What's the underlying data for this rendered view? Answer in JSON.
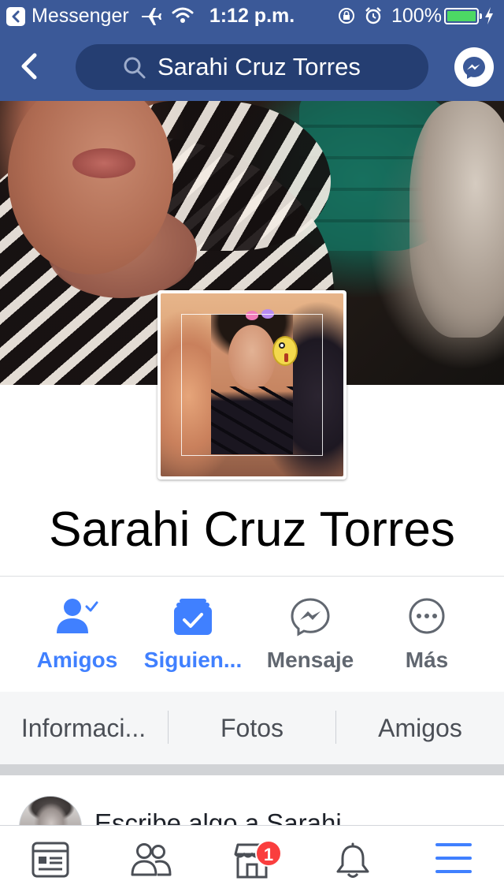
{
  "status_bar": {
    "back_app": "Messenger",
    "time": "1:12 p.m.",
    "battery_percent": "100%",
    "battery_level": 1.0
  },
  "nav": {
    "search_query": "Sarahi Cruz Torres"
  },
  "profile": {
    "name": "Sarahi Cruz Torres"
  },
  "actions": [
    {
      "label": "Amigos",
      "icon": "friends-check-icon",
      "active": true
    },
    {
      "label": "Siguien...",
      "icon": "following-icon",
      "active": true
    },
    {
      "label": "Mensaje",
      "icon": "messenger-icon",
      "active": false
    },
    {
      "label": "Más",
      "icon": "more-icon",
      "active": false
    }
  ],
  "tabs": [
    {
      "label": "Informaci..."
    },
    {
      "label": "Fotos"
    },
    {
      "label": "Amigos"
    }
  ],
  "composer": {
    "placeholder": "Escribe algo a Sarahi..."
  },
  "tab_bar": {
    "items": [
      {
        "icon": "news-feed-icon"
      },
      {
        "icon": "friend-requests-icon"
      },
      {
        "icon": "marketplace-icon",
        "badge": "1"
      },
      {
        "icon": "notifications-bell-icon"
      },
      {
        "icon": "menu-icon"
      }
    ]
  },
  "colors": {
    "brand": "#3b5998",
    "accent": "#4080ff",
    "badge": "#fa3e3e",
    "battery": "#4cd964"
  }
}
